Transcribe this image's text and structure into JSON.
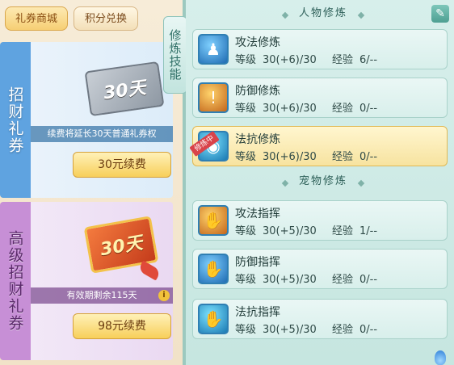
{
  "tabs": {
    "shop": "礼券商城",
    "exchange": "积分兑换"
  },
  "side_tab": "修炼技能",
  "cards": [
    {
      "title": "招财礼券",
      "ticket_text": "30天",
      "desc": "续费将延长30天普通礼券权",
      "button": "30元续费"
    },
    {
      "title": "高级招财礼券",
      "ticket_text": "30天",
      "desc": "有效期剩余115天",
      "info": "i",
      "button": "98元续费"
    }
  ],
  "sections": {
    "character": "人物修炼",
    "pet": "宠物修炼"
  },
  "edit_icon": "✎",
  "level_label": "等级",
  "exp_label": "经验",
  "skills": [
    {
      "name": "攻法修炼",
      "level": "30(+6)/30",
      "exp": "6/--",
      "icon": "cultivation-icon",
      "glyph": "♟"
    },
    {
      "name": "防御修炼",
      "level": "30(+6)/30",
      "exp": "0/--",
      "icon": "shield-icon",
      "glyph": "!"
    },
    {
      "name": "法抗修炼",
      "level": "30(+6)/30",
      "exp": "0/--",
      "icon": "resist-icon",
      "glyph": "◉",
      "badge": "修炼中"
    },
    {
      "name": "攻法指挥",
      "level": "30(+5)/30",
      "exp": "1/--",
      "icon": "paw-attack-icon",
      "glyph": "✋"
    },
    {
      "name": "防御指挥",
      "level": "30(+5)/30",
      "exp": "0/--",
      "icon": "paw-defense-icon",
      "glyph": "✋"
    },
    {
      "name": "法抗指挥",
      "level": "30(+5)/30",
      "exp": "0/--",
      "icon": "paw-resist-icon",
      "glyph": "✋"
    }
  ]
}
